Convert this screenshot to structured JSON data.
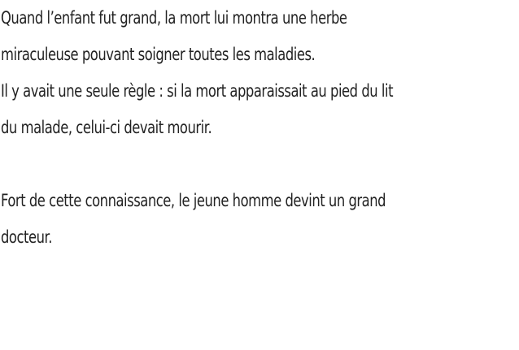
{
  "story": {
    "paragraph_1": {
      "line_1": "Quand l’enfant fut grand, la mort lui montra une herbe",
      "line_2": "miraculeuse pouvant soigner toutes les maladies.",
      "line_3": "Il y avait une seule règle : si la mort apparaissait au pied du lit",
      "line_4": "du malade, celui-ci devait mourir."
    },
    "paragraph_2": {
      "line_1": "Fort de cette connaissance, le jeune homme devint un grand",
      "line_2": "docteur."
    }
  }
}
